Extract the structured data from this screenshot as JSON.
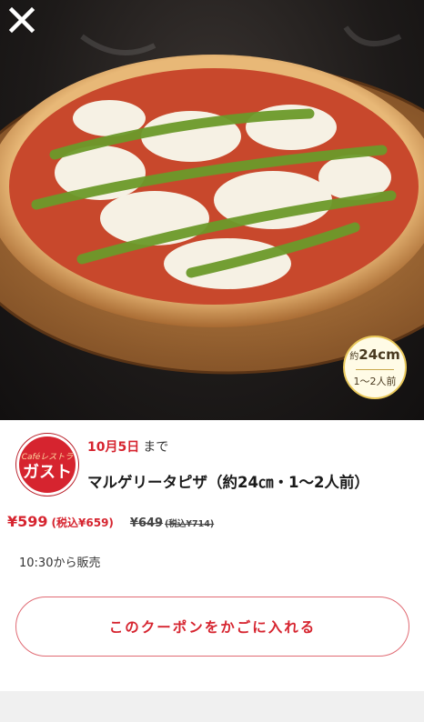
{
  "hero": {
    "image_desc_icon": "pizza-photo",
    "size_badge": {
      "prefix": "約",
      "size": "24cm",
      "servings": "1〜2人前"
    }
  },
  "close_icon": "close-icon",
  "brand": {
    "sub": "Caféレストラン",
    "name": "ガスト"
  },
  "deadline": {
    "date": "10月5日",
    "suffix": "まで"
  },
  "product": {
    "name": "マルゲリータピザ（約24㎝・1〜2人前）"
  },
  "price": {
    "current": "¥599",
    "current_tax": "(税込¥659)",
    "original": "¥649",
    "original_tax": "(税込¥714)"
  },
  "sale_time": "10:30から販売",
  "coupon_button": {
    "label": "このクーポンをかごに入れる"
  },
  "colors": {
    "accent": "#d6242f",
    "button_border": "#e06a73",
    "footer": "#f0f0f0"
  }
}
